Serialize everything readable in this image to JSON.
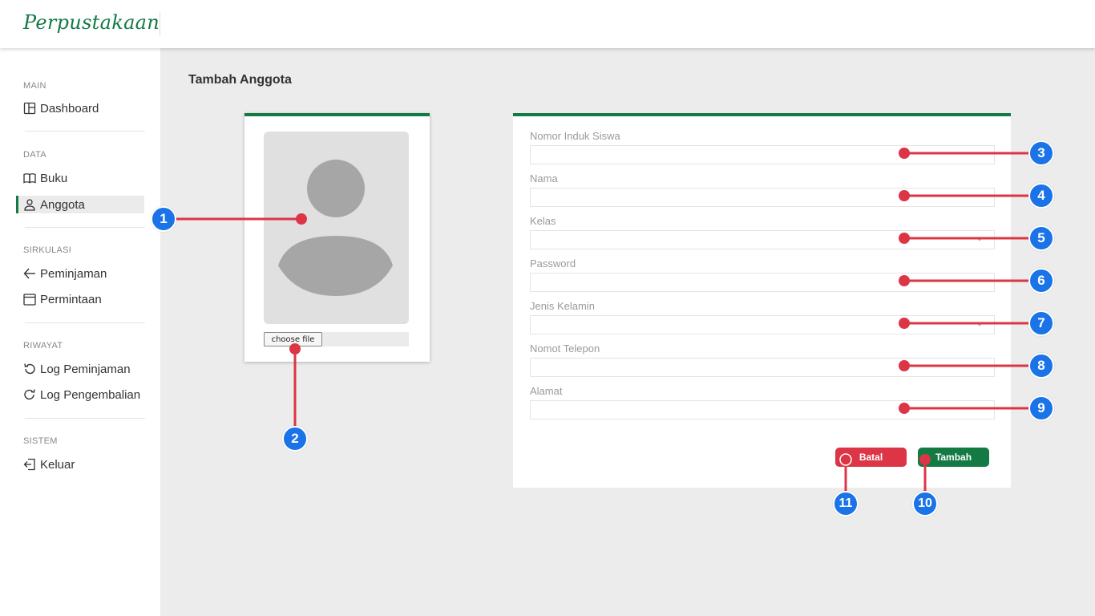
{
  "header": {
    "brand": "Perpustakaan"
  },
  "sidebar": {
    "sections": {
      "main": "MAIN",
      "data": "DATA",
      "sirkulasi": "SIRKULASI",
      "riwayat": "RIWAYAT",
      "sistem": "SISTEM"
    },
    "items": {
      "dashboard": "Dashboard",
      "buku": "Buku",
      "anggota": "Anggota",
      "peminjaman": "Peminjaman",
      "permintaan": "Permintaan",
      "log_peminjaman": "Log Peminjaman",
      "log_pengembalian": "Log Pengembalian",
      "keluar": "Keluar"
    },
    "active_item": "Anggota"
  },
  "main": {
    "title": "Tambah Anggota",
    "photo": {
      "file_button": "choose file"
    },
    "form": {
      "nis_label": "Nomor Induk Siswa",
      "nama_label": "Nama",
      "kelas_label": "Kelas",
      "password_label": "Password",
      "jenis_kelamin_label": "Jenis Kelamin",
      "telepon_label": "Nomot Telepon",
      "alamat_label": "Alamat",
      "batal_label": "Batal",
      "tambah_label": "Tambah"
    }
  },
  "annotations": [
    "1",
    "2",
    "3",
    "4",
    "5",
    "6",
    "7",
    "8",
    "9",
    "10",
    "11"
  ],
  "colors": {
    "brand": "#137a44",
    "danger": "#dc3545",
    "annotation_line": "#dc3545",
    "annotation_badge": "#1b73e8"
  }
}
